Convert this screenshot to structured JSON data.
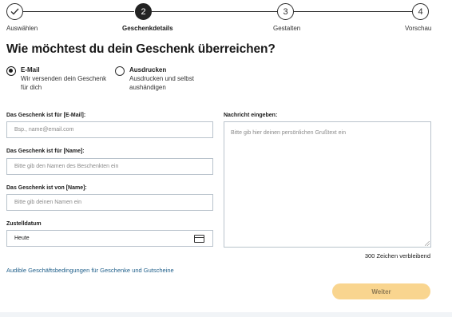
{
  "stepper": {
    "steps": [
      {
        "number": "",
        "label": "Auswählen",
        "state": "done"
      },
      {
        "number": "2",
        "label": "Geschenkdetails",
        "state": "active"
      },
      {
        "number": "3",
        "label": "Gestalten",
        "state": "todo"
      },
      {
        "number": "4",
        "label": "Vorschau",
        "state": "todo"
      }
    ]
  },
  "heading": "Wie möchtest du dein Geschenk überreichen?",
  "delivery_options": [
    {
      "title": "E-Mail",
      "desc_line1": "Wir versenden dein Geschenk",
      "desc_line2": "für dich",
      "selected": true
    },
    {
      "title": "Ausdrucken",
      "desc_line1": "Ausdrucken und selbst",
      "desc_line2": "aushändigen",
      "selected": false
    }
  ],
  "form": {
    "recipient_email": {
      "label": "Das Geschenk ist für [E-Mail]:",
      "placeholder": "Bsp., name@email.com"
    },
    "recipient_name": {
      "label": "Das Geschenk ist für [Name]:",
      "placeholder": "Bitte gib den Namen des Beschenkten ein"
    },
    "sender_name": {
      "label": "Das Geschenk ist von [Name]:",
      "placeholder": "Bitte gib deinen Namen ein"
    },
    "delivery_date": {
      "label": "Zustelldatum",
      "value": "Heute",
      "icon": "calendar-icon"
    },
    "message": {
      "label": "Nachricht eingeben:",
      "placeholder": "Bitte gib hier deinen persönlichen Grußtext ein",
      "char_count": "300 Zeichen verbleibend"
    }
  },
  "terms_link": "Audible Geschäftsbedingungen für Geschenke und Gutscheine",
  "next_button": "Weiter",
  "colors": {
    "accent": "#f9d58f",
    "link": "#1f5f8a",
    "dark": "#232323"
  }
}
